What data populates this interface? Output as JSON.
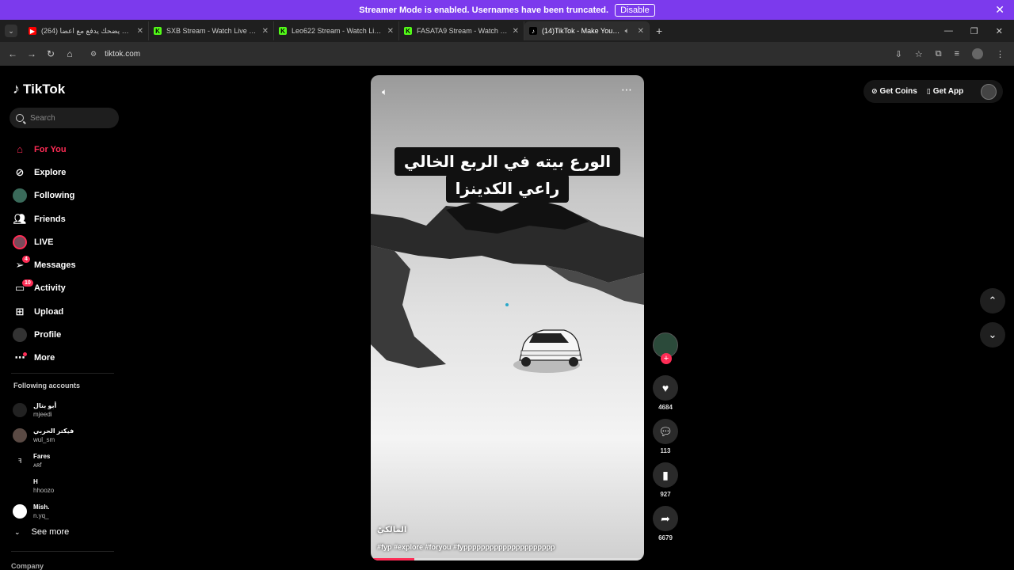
{
  "streamer_bar": {
    "message": "Streamer Mode is enabled. Usernames have been truncated.",
    "disable_label": "Disable"
  },
  "tabs": [
    {
      "title": "(264) اللي يضحك يدفع مع اعضا",
      "favicon_color": "#ff0000"
    },
    {
      "title": "SXB Stream - Watch Live on Kick",
      "favicon_color": "#53fc18"
    },
    {
      "title": "Leo622 Stream - Watch Live on Kick",
      "favicon_color": "#53fc18"
    },
    {
      "title": "FASATA9 Stream - Watch Live on Kick",
      "favicon_color": "#53fc18"
    },
    {
      "title": "(14)TikTok - Make Your Day",
      "favicon_color": "#000000"
    }
  ],
  "address": {
    "url": "tiktok.com"
  },
  "sidebar": {
    "logo": "TikTok",
    "search_placeholder": "Search",
    "nav": [
      {
        "label": "For You",
        "icon": "home-icon"
      },
      {
        "label": "Explore",
        "icon": "compass-icon"
      },
      {
        "label": "Following",
        "icon": "following-avatar"
      },
      {
        "label": "Friends",
        "icon": "friends-icon"
      },
      {
        "label": "LIVE",
        "icon": "live-avatar"
      },
      {
        "label": "Messages",
        "icon": "messages-icon",
        "badge": "4"
      },
      {
        "label": "Activity",
        "icon": "activity-icon",
        "badge": "10"
      },
      {
        "label": "Upload",
        "icon": "upload-icon"
      },
      {
        "label": "Profile",
        "icon": "profile-avatar"
      },
      {
        "label": "More",
        "icon": "more-icon"
      }
    ],
    "following_title": "Following accounts",
    "accounts": [
      {
        "display": "أبو بتال",
        "user": "mjeedi"
      },
      {
        "display": "فيكتر الحربي",
        "user": "wul_sm"
      },
      {
        "display": "Fares",
        "user": "ᴀʀf"
      },
      {
        "display": "H",
        "user": "hhoozo"
      },
      {
        "display": "Mish.",
        "user": "n.yq_"
      }
    ],
    "see_more": "See more",
    "company": "Company"
  },
  "video": {
    "caption_line1": "الورع بيته في الربع الخالي",
    "caption_line2": "راعي الكدينزا",
    "author": "المالكيّ",
    "tags": "#fyp #explore #foryou #fyppppppppppppppppppppp",
    "progress": 0.16
  },
  "actions": {
    "likes": "4684",
    "comments": "113",
    "saves": "927",
    "shares": "6679"
  },
  "topright": {
    "coins_label": "Get Coins",
    "app_label": "Get App"
  }
}
